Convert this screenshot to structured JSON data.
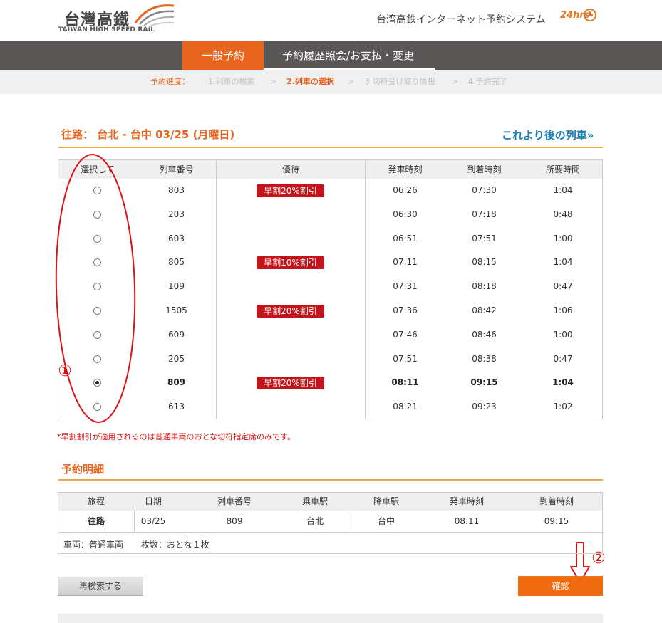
{
  "header": {
    "logo_cn": "台灣高鐵",
    "logo_en": "TAIWAN HIGH SPEED RAIL",
    "system_title": "台湾高鉄インターネット予約システム",
    "badge_24": "24hrs"
  },
  "nav": {
    "tab_booking": "一般予約",
    "tab_history": "予約履歴照会/お支払・変更"
  },
  "progress": {
    "label": "予約進度：",
    "steps": [
      "1.列車の検索",
      "2.列車の選択",
      "3.切符受け取り情報",
      "4.予約完了"
    ],
    "separator": ">",
    "active_step": 2
  },
  "route": {
    "title": "往路： 台北 - 台中 03/25 (月曜日)",
    "next_trains": "これより後の列車»"
  },
  "train_table": {
    "headers": [
      "選択して",
      "列車番号",
      "優待",
      "発車時刻",
      "到着時刻",
      "所要時間"
    ],
    "rows": [
      {
        "train": "803",
        "discount": "早割20%割引",
        "dep": "06:26",
        "arr": "07:30",
        "dur": "1:04",
        "selected": false
      },
      {
        "train": "203",
        "discount": "",
        "dep": "06:30",
        "arr": "07:18",
        "dur": "0:48",
        "selected": false
      },
      {
        "train": "603",
        "discount": "",
        "dep": "06:51",
        "arr": "07:51",
        "dur": "1:00",
        "selected": false
      },
      {
        "train": "805",
        "discount": "早割10%割引",
        "dep": "07:11",
        "arr": "08:15",
        "dur": "1:04",
        "selected": false
      },
      {
        "train": "109",
        "discount": "",
        "dep": "07:31",
        "arr": "08:18",
        "dur": "0:47",
        "selected": false
      },
      {
        "train": "1505",
        "discount": "早割20%割引",
        "dep": "07:36",
        "arr": "08:42",
        "dur": "1:06",
        "selected": false
      },
      {
        "train": "609",
        "discount": "",
        "dep": "07:46",
        "arr": "08:46",
        "dur": "1:00",
        "selected": false
      },
      {
        "train": "205",
        "discount": "",
        "dep": "07:51",
        "arr": "08:38",
        "dur": "0:47",
        "selected": false
      },
      {
        "train": "809",
        "discount": "早割20%割引",
        "dep": "08:11",
        "arr": "09:15",
        "dur": "1:04",
        "selected": true
      },
      {
        "train": "613",
        "discount": "",
        "dep": "08:21",
        "arr": "09:23",
        "dur": "1:02",
        "selected": false
      }
    ]
  },
  "note": "*早割割引が適用されるのは普通車両のおとな切符指定席のみです。",
  "details": {
    "title": "予約明細",
    "headers": [
      "旅程",
      "日期",
      "列車番号",
      "乗車駅",
      "降車駅",
      "発車時刻",
      "到着時刻"
    ],
    "row": [
      "往路",
      "03/25",
      "809",
      "台北",
      "台中",
      "08:11",
      "09:15"
    ],
    "car": "車両：普通車両",
    "tickets": "枚数：おとな１枚"
  },
  "buttons": {
    "research": "再検索する",
    "confirm": "確認"
  },
  "annotations": {
    "marker_1": "①",
    "marker_2": "②"
  },
  "colors": {
    "accent_orange": "#e8631c",
    "nav_gray": "#5a5655",
    "discount_red": "#c4141b",
    "link_blue": "#1b7fb5",
    "annotation_red": "#dd1111"
  }
}
